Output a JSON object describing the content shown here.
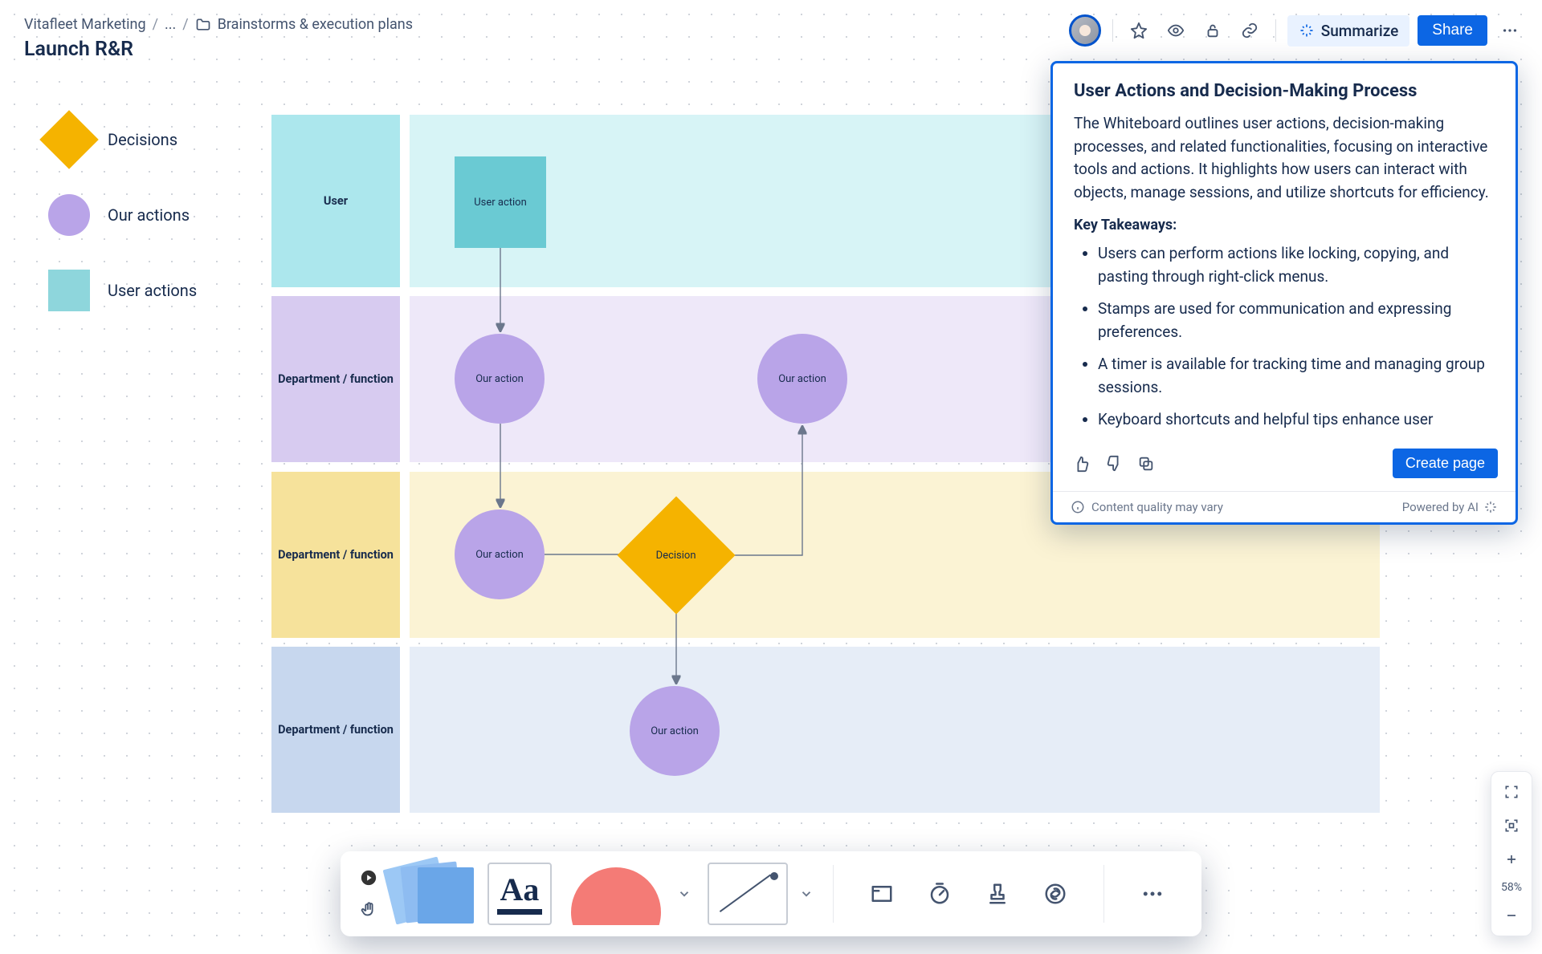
{
  "breadcrumb": {
    "root": "Vitafleet Marketing",
    "mid": "...",
    "folder": "Brainstorms & execution plans"
  },
  "page_title": "Launch R&R",
  "header_actions": {
    "summarize": "Summarize",
    "share": "Share"
  },
  "legend": {
    "decisions": "Decisions",
    "our_actions": "Our actions",
    "user_actions": "User actions"
  },
  "lanes": {
    "user": "User",
    "dept1": "Department / function",
    "dept2": "Department / function",
    "dept3": "Department / function"
  },
  "shapes": {
    "user_action": "User action",
    "our_action": "Our action",
    "decision": "Decision"
  },
  "ai_panel": {
    "title": "User Actions and Decision-Making Process",
    "body": "The Whiteboard outlines user actions, decision-making processes, and related functionalities, focusing on interactive tools and actions. It highlights how users can interact with objects, manage sessions, and utilize shortcuts for efficiency.",
    "key_takeaways_heading": "Key Takeaways:",
    "bullets": [
      "Users can perform actions like locking, copying, and pasting through right-click menus.",
      "Stamps are used for communication and expressing preferences.",
      "A timer is available for tracking time and managing group sessions.",
      "Keyboard shortcuts and helpful tips enhance user"
    ],
    "create_page": "Create page",
    "quality_note": "Content quality may vary",
    "powered_by": "Powered by AI"
  },
  "toolbar": {
    "text_label": "Aa"
  },
  "zoom": {
    "percent": "58%"
  }
}
